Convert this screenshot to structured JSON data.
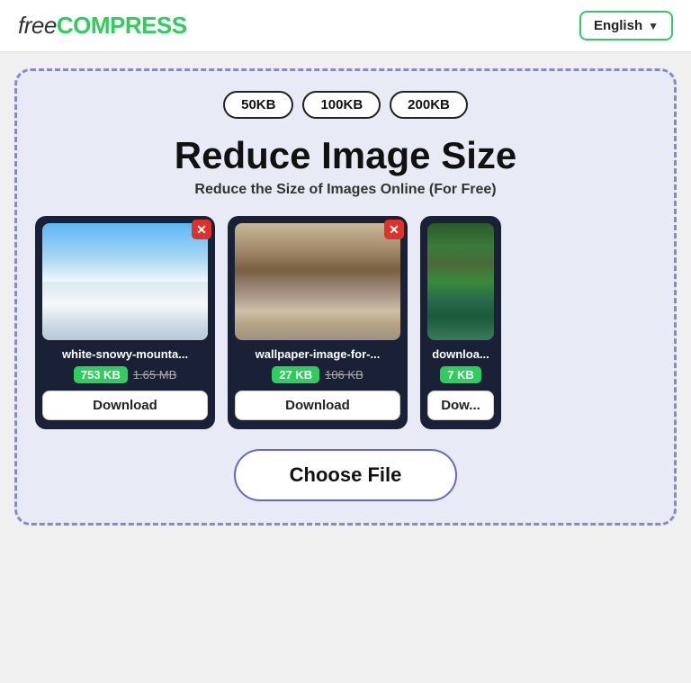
{
  "header": {
    "logo_free": "free",
    "logo_compress": "COMPRESS",
    "language_label": "English",
    "chevron": "▼"
  },
  "size_chips": [
    "50KB",
    "100KB",
    "200KB"
  ],
  "hero": {
    "title": "Reduce Image Size",
    "subtitle": "Reduce the Size of Images Online (For Free)"
  },
  "cards": [
    {
      "filename": "white-snowy-mounta...",
      "size_new": "753 KB",
      "size_old": "1.65 MB",
      "img_type": "snowy",
      "download_label": "Download"
    },
    {
      "filename": "wallpaper-image-for-...",
      "size_new": "27 KB",
      "size_old": "106 KB",
      "img_type": "mountain",
      "download_label": "Download"
    },
    {
      "filename": "downloa...",
      "size_new": "7 KB",
      "size_old": "...",
      "img_type": "forest",
      "download_label": "Dow..."
    }
  ],
  "choose_file_label": "Choose File"
}
